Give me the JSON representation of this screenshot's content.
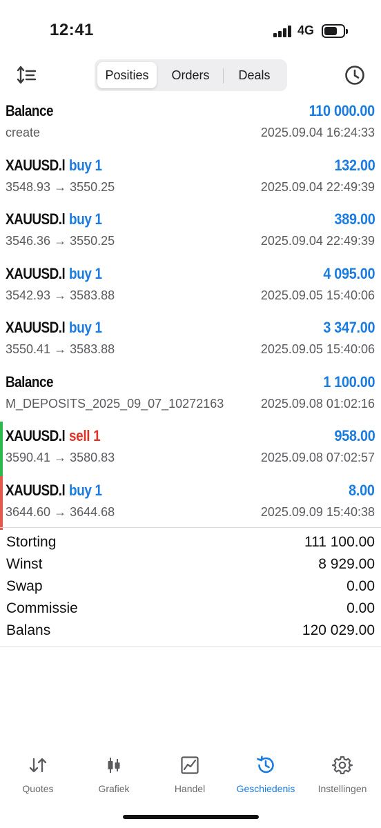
{
  "status_bar": {
    "time": "12:41",
    "network": "4G"
  },
  "toolbar": {
    "tabs": [
      {
        "label": "Posities",
        "active": true
      },
      {
        "label": "Orders",
        "active": false
      },
      {
        "label": "Deals",
        "active": false
      }
    ],
    "sort_icon": "sort-lines-icon",
    "history_icon": "clock-icon"
  },
  "deals": [
    {
      "symbol": "Balance",
      "side": "",
      "profit": "110 000.00",
      "detail": "create",
      "time": "2025.09.04 16:24:33",
      "marker": ""
    },
    {
      "symbol": "XAUUSD.l",
      "side": "buy 1",
      "side_type": "buy",
      "profit": "132.00",
      "detail": "3548.93 → 3550.25",
      "time": "2025.09.04 22:49:39",
      "marker": ""
    },
    {
      "symbol": "XAUUSD.l",
      "side": "buy 1",
      "side_type": "buy",
      "profit": "389.00",
      "detail": "3546.36 → 3550.25",
      "time": "2025.09.04 22:49:39",
      "marker": ""
    },
    {
      "symbol": "XAUUSD.l",
      "side": "buy 1",
      "side_type": "buy",
      "profit": "4 095.00",
      "detail": "3542.93 → 3583.88",
      "time": "2025.09.05 15:40:06",
      "marker": ""
    },
    {
      "symbol": "XAUUSD.l",
      "side": "buy 1",
      "side_type": "buy",
      "profit": "3 347.00",
      "detail": "3550.41 → 3583.88",
      "time": "2025.09.05 15:40:06",
      "marker": ""
    },
    {
      "symbol": "Balance",
      "side": "",
      "profit": "1 100.00",
      "detail": "M_DEPOSITS_2025_09_07_10272163",
      "time": "2025.09.08 01:02:16",
      "marker": ""
    },
    {
      "symbol": "XAUUSD.l",
      "side": "sell 1",
      "side_type": "sell",
      "profit": "958.00",
      "detail": "3590.41 → 3580.83",
      "time": "2025.09.08 07:02:57",
      "marker": "#2cb84a"
    },
    {
      "symbol": "XAUUSD.l",
      "side": "buy 1",
      "side_type": "buy",
      "profit": "8.00",
      "detail": "3644.60 → 3644.68",
      "time": "2025.09.09 15:40:38",
      "marker": "#e25a4c"
    }
  ],
  "summary": [
    {
      "label": "Storting",
      "value": "111 100.00"
    },
    {
      "label": "Winst",
      "value": "8 929.00"
    },
    {
      "label": "Swap",
      "value": "0.00"
    },
    {
      "label": "Commissie",
      "value": "0.00"
    },
    {
      "label": "Balans",
      "value": "120 029.00"
    }
  ],
  "tabbar": [
    {
      "label": "Quotes",
      "icon": "quotes-arrows-icon",
      "active": false
    },
    {
      "label": "Grafiek",
      "icon": "candlestick-icon",
      "active": false
    },
    {
      "label": "Handel",
      "icon": "trade-chart-icon",
      "active": false
    },
    {
      "label": "Geschiedenis",
      "icon": "history-icon",
      "active": true
    },
    {
      "label": "Instellingen",
      "icon": "gear-icon",
      "active": false
    }
  ],
  "colors": {
    "accent": "#1a7be0",
    "sell": "#e03226",
    "text": "#1c1c1e",
    "muted": "#5b5b60"
  }
}
